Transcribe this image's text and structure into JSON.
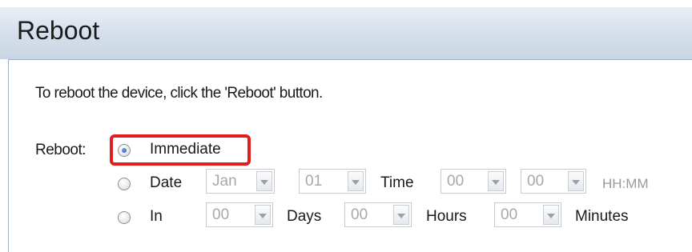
{
  "page": {
    "title": "Reboot",
    "instruction": "To reboot the device, click the 'Reboot' button."
  },
  "reboot": {
    "label": "Reboot:",
    "options": [
      {
        "label": "Immediate",
        "selected": true
      },
      {
        "label": "Date",
        "selected": false
      },
      {
        "label": "In",
        "selected": false
      }
    ],
    "date": {
      "month": "Jan",
      "day": "01",
      "time_label": "Time",
      "hour": "00",
      "minute": "00",
      "format_hint": "HH:MM"
    },
    "in": {
      "days": "00",
      "days_label": "Days",
      "hours": "00",
      "hours_label": "Hours",
      "minutes": "00",
      "minutes_label": "Minutes"
    }
  },
  "colors": {
    "highlight": "#e11d1d",
    "title_bar": "#d6e0ec",
    "disabled_text": "#a8a8a8"
  }
}
